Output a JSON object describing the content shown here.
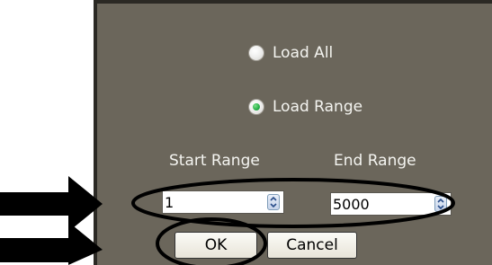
{
  "options": {
    "load_all": {
      "label": "Load All",
      "selected": false
    },
    "load_range": {
      "label": "Load Range",
      "selected": true
    }
  },
  "range": {
    "start_label": "Start Range",
    "end_label": "End Range",
    "start_value": "1",
    "end_value": "5000"
  },
  "buttons": {
    "ok": "OK",
    "cancel": "Cancel"
  },
  "colors": {
    "dialog_bg": "#6b665b",
    "annotation": "#000000"
  }
}
